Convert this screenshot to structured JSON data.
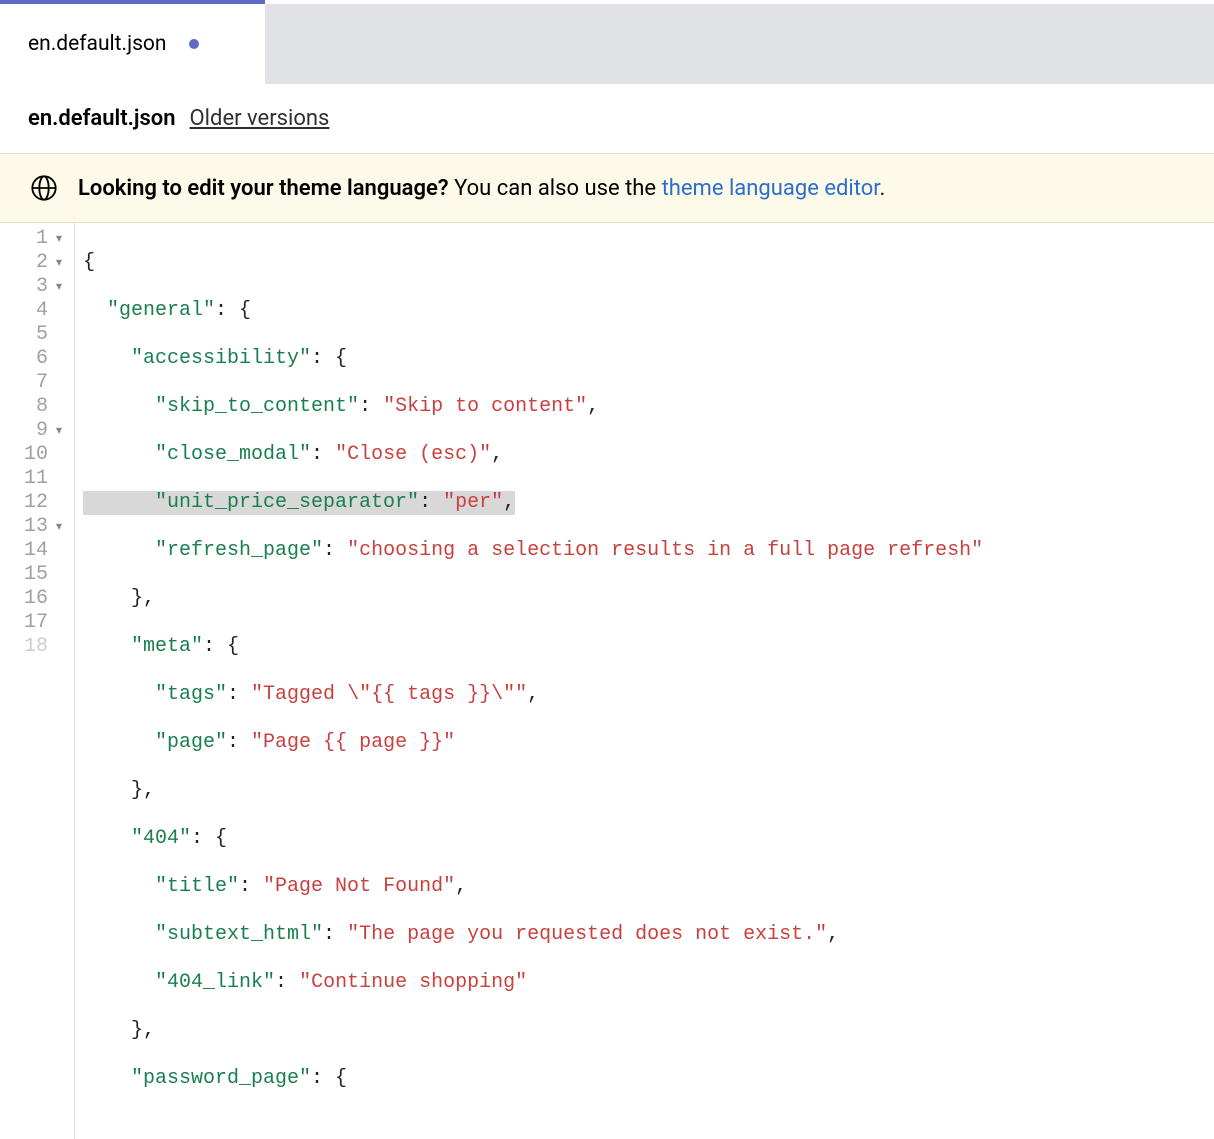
{
  "tab": {
    "label": "en.default.json",
    "modified": true
  },
  "header": {
    "filename": "en.default.json",
    "older_versions": "Older versions"
  },
  "notice": {
    "bold": "Looking to edit your theme language?",
    "rest": " You can also use the ",
    "link": "theme language editor",
    "period": "."
  },
  "code": {
    "lines": [
      {
        "n": 1,
        "fold": true
      },
      {
        "n": 2,
        "fold": true
      },
      {
        "n": 3,
        "fold": true
      },
      {
        "n": 4,
        "fold": false
      },
      {
        "n": 5,
        "fold": false
      },
      {
        "n": 6,
        "fold": false
      },
      {
        "n": 7,
        "fold": false
      },
      {
        "n": 8,
        "fold": false
      },
      {
        "n": 9,
        "fold": true
      },
      {
        "n": 10,
        "fold": false
      },
      {
        "n": 11,
        "fold": false
      },
      {
        "n": 12,
        "fold": false
      },
      {
        "n": 13,
        "fold": true
      },
      {
        "n": 14,
        "fold": false
      },
      {
        "n": 15,
        "fold": false
      },
      {
        "n": 16,
        "fold": false
      },
      {
        "n": 17,
        "fold": false
      },
      {
        "n": 18,
        "fold": false
      }
    ],
    "l1_brace": "{",
    "l2_key": "\"general\"",
    "l2_after": ": {",
    "l3_key": "\"accessibility\"",
    "l3_after": ": {",
    "l4_key": "\"skip_to_content\"",
    "l4_sep": ": ",
    "l4_val": "\"Skip to content\"",
    "l4_end": ",",
    "l5_key": "\"close_modal\"",
    "l5_sep": ": ",
    "l5_val": "\"Close (esc)\"",
    "l5_end": ",",
    "l6_key": "\"unit_price_separator\"",
    "l6_sep": ": ",
    "l6_val": "\"per\"",
    "l6_end": ",",
    "l7_key": "\"refresh_page\"",
    "l7_sep": ": ",
    "l7_val": "\"choosing a selection results in a full page refresh\"",
    "l8_close": "},",
    "l9_key": "\"meta\"",
    "l9_after": ": {",
    "l10_key": "\"tags\"",
    "l10_sep": ": ",
    "l10_val": "\"Tagged \\\"{{ tags }}\\\"\"",
    "l10_end": ",",
    "l11_key": "\"page\"",
    "l11_sep": ": ",
    "l11_val": "\"Page {{ page }}\"",
    "l12_close": "},",
    "l13_key": "\"404\"",
    "l13_after": ": {",
    "l14_key": "\"title\"",
    "l14_sep": ": ",
    "l14_val": "\"Page Not Found\"",
    "l14_end": ",",
    "l15_key": "\"subtext_html\"",
    "l15_sep": ": ",
    "l15_val": "\"The page you requested does not exist.\"",
    "l15_end": ",",
    "l16_key": "\"404_link\"",
    "l16_sep": ": ",
    "l16_val": "\"Continue shopping\"",
    "l17_close": "},",
    "l18_key": "\"password_page\"",
    "l18_after": ": {"
  }
}
